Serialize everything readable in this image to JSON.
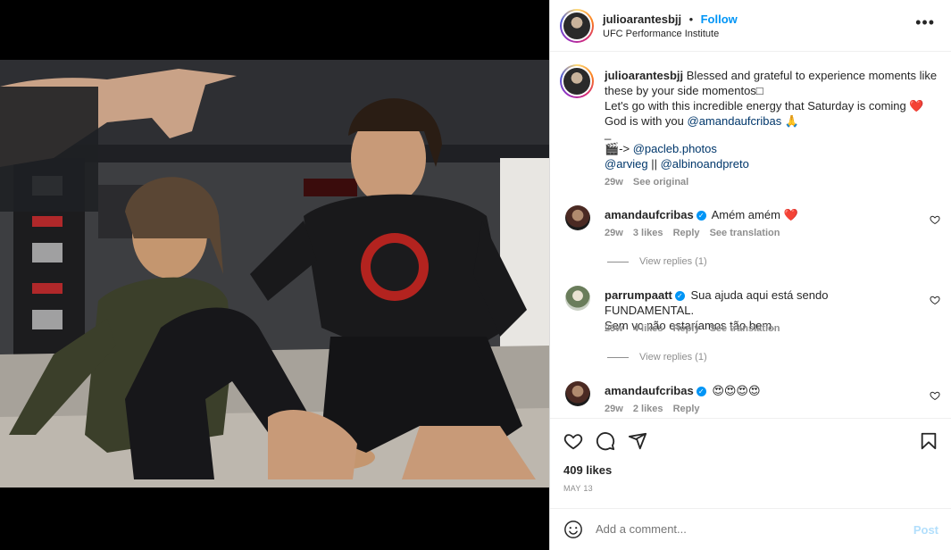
{
  "post": {
    "username": "julioarantesbjj",
    "separator": "•",
    "follow_label": "Follow",
    "location": "UFC Performance Institute",
    "more_label": "•••"
  },
  "caption": {
    "username": "julioarantesbjj",
    "line1": "Blessed and grateful to experience moments like",
    "line2": "these by your side momentos□",
    "line3": "Let's go with this incredible energy that Saturday is coming",
    "line3_emoji": "❤️",
    "line4_prefix": "God is with you",
    "line4_mention": "@amandaufcribas",
    "line4_emoji": "🙏",
    "dash": "_",
    "line6_prefix": "🎬-> ",
    "line6_mention": "@pacleb.photos",
    "line7_mention_a": "@arvieg",
    "line7_sep": " || ",
    "line7_mention_b": "@albinoandpreto",
    "time": "29w",
    "see_original": "See original"
  },
  "comments": [
    {
      "username": "amandaufcribas",
      "verified": true,
      "text": "Amém amém",
      "emoji": "❤️",
      "time": "29w",
      "likes": "3 likes",
      "reply": "Reply",
      "translate": "See translation",
      "view_replies": "View replies (1)"
    },
    {
      "username": "parrumpaatt",
      "verified": true,
      "text_line1": "Sua ajuda aqui está sendo FUNDAMENTAL.",
      "text_line2": "Sem vc não estaríamos tão bem.",
      "time": "29w",
      "likes": "4 likes",
      "reply": "Reply",
      "translate": "See translation",
      "view_replies": "View replies (1)"
    },
    {
      "username": "amandaufcribas",
      "verified": true,
      "text": "😍😍😍😍",
      "time": "29w",
      "likes": "2 likes",
      "reply": "Reply"
    }
  ],
  "actions": {
    "likes": "409 likes",
    "date": "MAY 13",
    "icons": [
      "heart-icon",
      "comment-icon",
      "share-icon",
      "bookmark-icon"
    ]
  },
  "add_comment": {
    "placeholder": "Add a comment...",
    "post_label": "Post"
  },
  "colors": {
    "accent": "#0095f6",
    "heart": "#ed4956",
    "muted": "#8e8e8e",
    "link": "#00376b"
  }
}
